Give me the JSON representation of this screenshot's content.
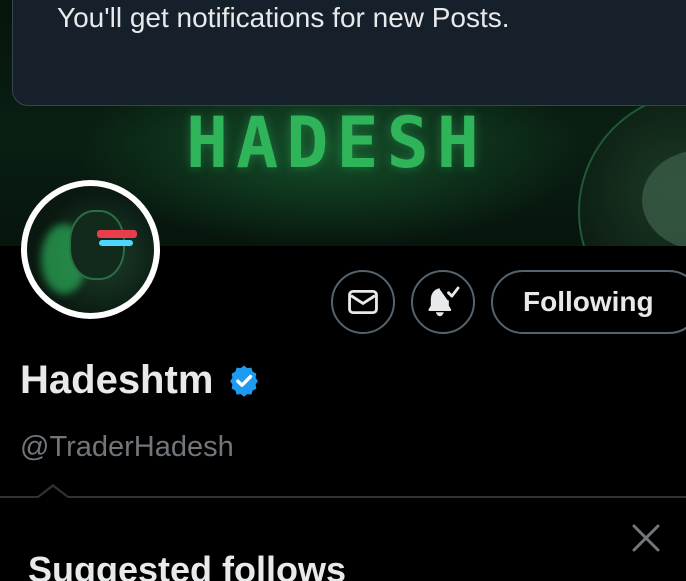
{
  "toast": {
    "message": "You'll get notifications for new Posts."
  },
  "banner": {
    "wordmark": "HADESH",
    "accent_color": "#2fb45a"
  },
  "profile": {
    "display_name": "Hadeshtm",
    "handle": "@TraderHadesh",
    "verified": true,
    "verified_color": "#1d9bf0"
  },
  "actions": {
    "message_icon": "mail-icon",
    "notify_icon": "bell-check-icon",
    "follow_label": "Following"
  },
  "suggested": {
    "title": "Suggested follows",
    "close_icon": "close-icon"
  }
}
